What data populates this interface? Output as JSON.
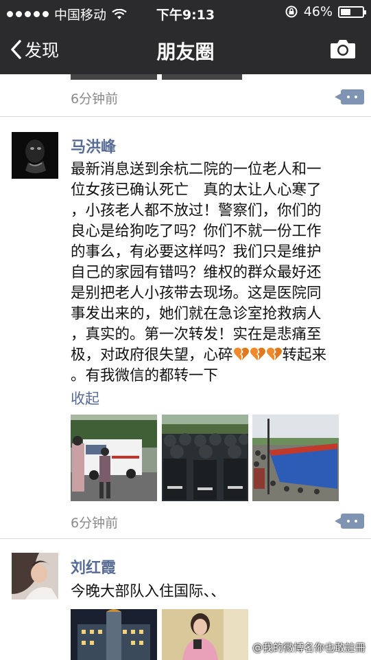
{
  "status_bar": {
    "carrier": "中国移动",
    "time": "下午9:13",
    "battery_percent": "46%",
    "battery_level": 0.46
  },
  "nav": {
    "back_label": "发现",
    "title": "朋友圈",
    "camera_icon": "camera-icon"
  },
  "feed": {
    "posts": [
      {
        "time": "6分钟前"
      },
      {
        "author": "马洪峰",
        "lines": [
          "最新消息送到余杭二院的一位老人和一",
          "位女孩已确认死亡　真的太让人心寒了",
          "，小孩老人都不放过！警察们，你们的",
          "良心是给狗吃了吗？你们不就一份工作",
          "的事么，有必要这样吗？我们只是维护",
          "自己的家园有错吗？维权的群众最好还",
          "是别把老人小孩带去现场。这是医院同",
          "事发出来的，她们就在急诊室抢救病人",
          "，真实的。第一次转发！实在是悲痛至"
        ],
        "line10_pre": "极，对政府很失望，心碎",
        "line10_post": "转起来",
        "line11": "。有我微信的都转一下",
        "heart_icon": "broken-heart-icon",
        "collapse_label": "收起",
        "time": "6分钟前"
      },
      {
        "author": "刘红霞",
        "text": "今晚大部队入住国际、、"
      }
    ]
  },
  "watermark": "@我的微博名你也敢註冊",
  "colors": {
    "bar_bg": "#2b2b2d",
    "name_blue": "#576b95",
    "time_gray": "#8a8a8a",
    "broken_heart": "#f08a2c"
  }
}
